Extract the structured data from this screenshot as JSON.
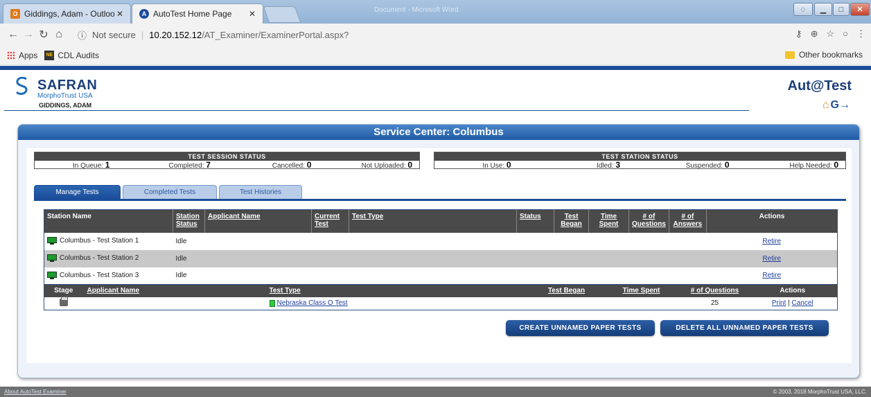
{
  "browser": {
    "tabs": [
      {
        "label": "Giddings, Adam - Outloo",
        "icon": "outlook-icon"
      },
      {
        "label": "AutoTest Home Page",
        "icon": "autotest-icon"
      }
    ],
    "background_window_title": "Document - Microsoft Word",
    "security_label": "Not secure",
    "url_host": "10.20.152.12",
    "url_path": "/AT_Examiner/ExaminerPortal.aspx?",
    "bookmarks": [
      {
        "label": "Apps",
        "icon": "apps-grid-icon"
      },
      {
        "label": "CDL Audits",
        "icon": "ne-icon"
      }
    ],
    "other_bookmarks": "Other bookmarks"
  },
  "header": {
    "brand": "SAFRAN",
    "brand_sub": "MorphoTrust USA",
    "user": "GIDDINGS, ADAM",
    "product": "Aut@Test"
  },
  "panel": {
    "title": "Service Center: Columbus"
  },
  "session_status": {
    "title": "TEST SESSION STATUS",
    "items": [
      {
        "label": "In Queue:",
        "value": "1"
      },
      {
        "label": "Completed:",
        "value": "7"
      },
      {
        "label": "Cancelled:",
        "value": "0"
      },
      {
        "label": "Not Uploaded:",
        "value": "0"
      }
    ]
  },
  "station_status": {
    "title": "TEST STATION STATUS",
    "items": [
      {
        "label": "In Use:",
        "value": "0"
      },
      {
        "label": "Idled:",
        "value": "3"
      },
      {
        "label": "Suspended:",
        "value": "0"
      },
      {
        "label": "Help Needed:",
        "value": "0"
      }
    ]
  },
  "tabs": [
    "Manage Tests",
    "Completed Tests",
    "Test Histories"
  ],
  "stations_table": {
    "headers": {
      "station_name": "Station Name",
      "station_status": "Station Status",
      "applicant_name": "Applicant Name",
      "current_test": "Current Test",
      "test_type": "Test Type",
      "status": "Status",
      "test_began": "Test Began",
      "time_spent": "Time Spent",
      "num_questions": "# of Questions",
      "num_answers": "# of Answers",
      "actions": "Actions"
    },
    "rows": [
      {
        "name": "Columbus - Test Station 1",
        "status": "Idle",
        "action": "Retire"
      },
      {
        "name": "Columbus - Test Station 2",
        "status": "Idle",
        "action": "Retire"
      },
      {
        "name": "Columbus - Test Station 3",
        "status": "Idle",
        "action": "Retire"
      }
    ]
  },
  "queue_table": {
    "headers": {
      "stage": "Stage",
      "applicant_name": "Applicant Name",
      "test_type": "Test Type",
      "test_began": "Test Began",
      "time_spent": "Time Spent",
      "num_questions": "# of Questions",
      "actions": "Actions"
    },
    "rows": [
      {
        "test_type": "Nebraska Class O Test",
        "questions": "25",
        "print": "Print",
        "sep": "|",
        "cancel": "Cancel"
      }
    ]
  },
  "buttons": {
    "create": "CREATE UNNAMED PAPER TESTS",
    "delete": "DELETE ALL UNNAMED PAPER TESTS"
  },
  "footer": {
    "about": "About AutoTest Examiner",
    "copyright": "© 2003, 2018 MorphoTrust USA, LLC."
  }
}
